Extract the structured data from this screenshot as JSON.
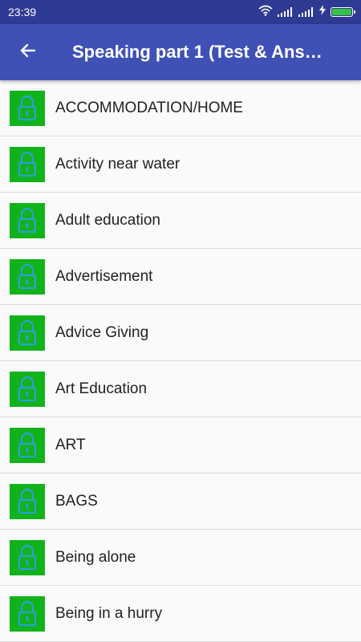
{
  "status_bar": {
    "time": "23:39"
  },
  "app_bar": {
    "title": "Speaking part 1 (Test & Ans…",
    "back_icon": "arrow-back-icon",
    "color": "#3f51b5"
  },
  "list": {
    "item_icon": "lock-icon",
    "item_icon_color": "#12b21b",
    "items": [
      {
        "label": "ACCOMMODATION/HOME"
      },
      {
        "label": "Activity near water"
      },
      {
        "label": "Adult education"
      },
      {
        "label": "Advertisement"
      },
      {
        "label": "Advice Giving"
      },
      {
        "label": "Art Education"
      },
      {
        "label": "ART"
      },
      {
        "label": "BAGS"
      },
      {
        "label": "Being alone"
      },
      {
        "label": "Being in a hurry"
      }
    ]
  }
}
